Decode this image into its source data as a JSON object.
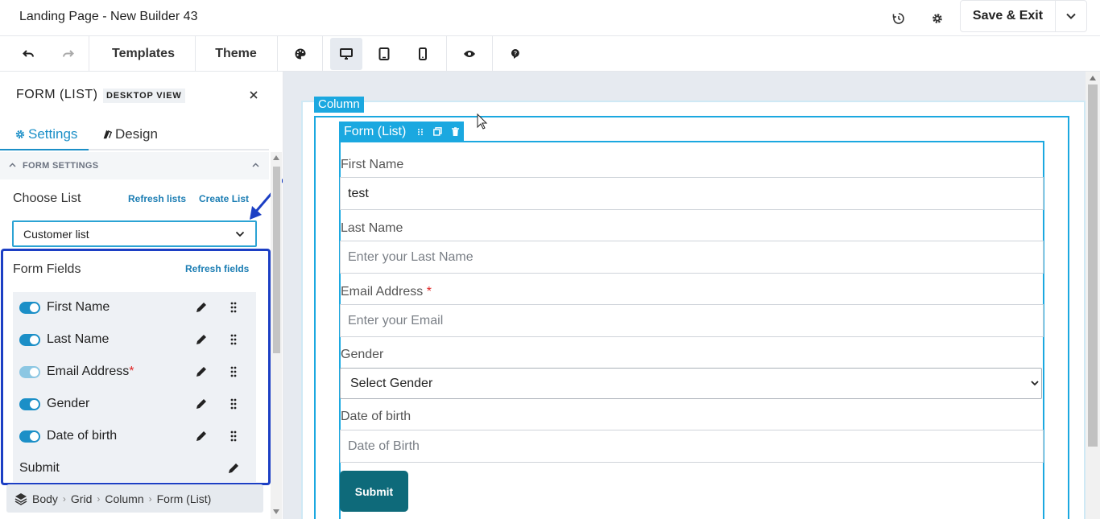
{
  "app": {
    "title": "Landing Page - New Builder 43",
    "save_label": "Save & Exit"
  },
  "toolbar": {
    "templates": "Templates",
    "theme": "Theme",
    "icons": [
      "undo-icon",
      "redo-icon",
      "palette-icon",
      "desktop-icon",
      "tablet-icon",
      "mobile-icon",
      "preview-eye-icon",
      "help-icon"
    ],
    "active_device": "desktop"
  },
  "panel": {
    "title": "FORM (LIST)",
    "badge": "DESKTOP VIEW",
    "tabs": [
      {
        "label": "Settings",
        "active": true
      },
      {
        "label": "Design",
        "active": false
      }
    ],
    "section": "FORM SETTINGS",
    "choose_list_label": "Choose List",
    "refresh_lists": "Refresh lists",
    "create_list": "Create List",
    "selected_list": "Customer list",
    "form_fields_label": "Form Fields",
    "refresh_fields": "Refresh fields",
    "fields": [
      {
        "name": "First Name",
        "required": "",
        "enabled": true
      },
      {
        "name": "Last Name",
        "required": "",
        "enabled": true
      },
      {
        "name": "Email Address",
        "required": "*",
        "enabled": true
      },
      {
        "name": "Gender",
        "required": "",
        "enabled": true
      },
      {
        "name": "Date of birth",
        "required": "",
        "enabled": true
      }
    ],
    "submit_label": "Submit"
  },
  "breadcrumb": [
    "Body",
    "Grid",
    "Column",
    "Form (List)"
  ],
  "canvas": {
    "column_label": "Column",
    "form_label": "Form (List)",
    "first_name_label": "First Name",
    "first_name_value": "test",
    "last_name_label": "Last Name",
    "last_name_placeholder": "Enter your Last Name",
    "email_label": "Email Address",
    "email_required": "*",
    "email_placeholder": "Enter your Email",
    "gender_label": "Gender",
    "gender_selected": "Select Gender",
    "dob_label": "Date of birth",
    "dob_placeholder": "Date of Birth",
    "submit": "Submit"
  },
  "colors": {
    "accent": "#1b8fc7",
    "highlight_border": "#1c3fc4",
    "selection_blue": "#1ba8e0",
    "submit_bg": "#0e6a7a",
    "required": "#e02424"
  }
}
